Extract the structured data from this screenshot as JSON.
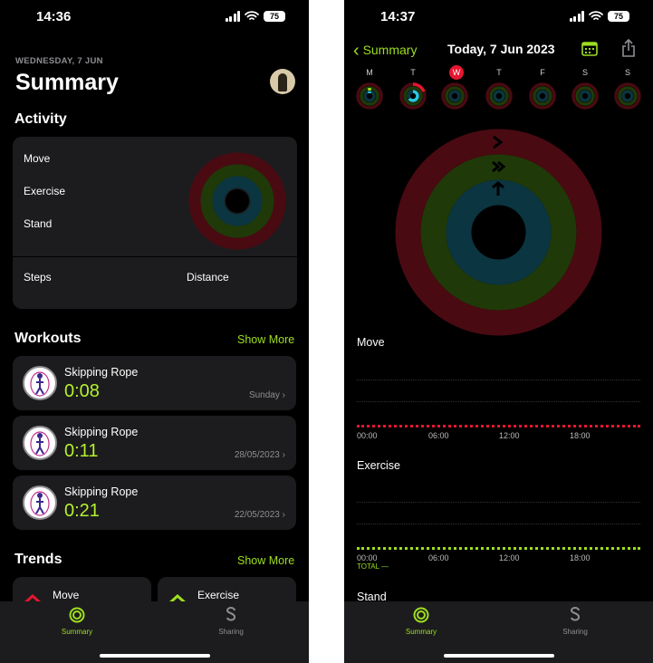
{
  "left": {
    "status": {
      "time": "14:36",
      "battery": "75"
    },
    "date": "WEDNESDAY, 7 JUN",
    "title": "Summary",
    "activity": {
      "heading": "Activity",
      "rows": [
        "Move",
        "Exercise",
        "Stand"
      ],
      "steps_label": "Steps",
      "distance_label": "Distance"
    },
    "workouts": {
      "heading": "Workouts",
      "show_more": "Show More",
      "items": [
        {
          "name": "Skipping Rope",
          "time": "0:08",
          "date": "Sunday"
        },
        {
          "name": "Skipping Rope",
          "time": "0:11",
          "date": "28/05/2023"
        },
        {
          "name": "Skipping Rope",
          "time": "0:21",
          "date": "22/05/2023"
        }
      ]
    },
    "trends": {
      "heading": "Trends",
      "show_more": "Show More",
      "items": [
        "Move",
        "Exercise"
      ]
    },
    "tabs": {
      "summary": "Summary",
      "sharing": "Sharing"
    }
  },
  "right": {
    "status": {
      "time": "14:37",
      "battery": "75"
    },
    "nav": {
      "back_label": "Summary",
      "title": "Today, 7 Jun 2023"
    },
    "week_days": [
      "M",
      "T",
      "W",
      "T",
      "F",
      "S",
      "S"
    ],
    "selected_day_index": 2,
    "move": {
      "label": "Move",
      "ticks": [
        "00:00",
        "06:00",
        "12:00",
        "18:00"
      ]
    },
    "exercise": {
      "label": "Exercise",
      "ticks": [
        "00:00",
        "06:00",
        "12:00",
        "18:00"
      ],
      "total_label": "TOTAL —"
    },
    "stand": {
      "label": "Stand"
    },
    "tabs": {
      "summary": "Summary",
      "sharing": "Sharing"
    }
  },
  "colors": {
    "move": "#e5162f",
    "exercise": "#9ede1f",
    "stand": "#2ec5e0",
    "accent": "#9ede1f"
  }
}
